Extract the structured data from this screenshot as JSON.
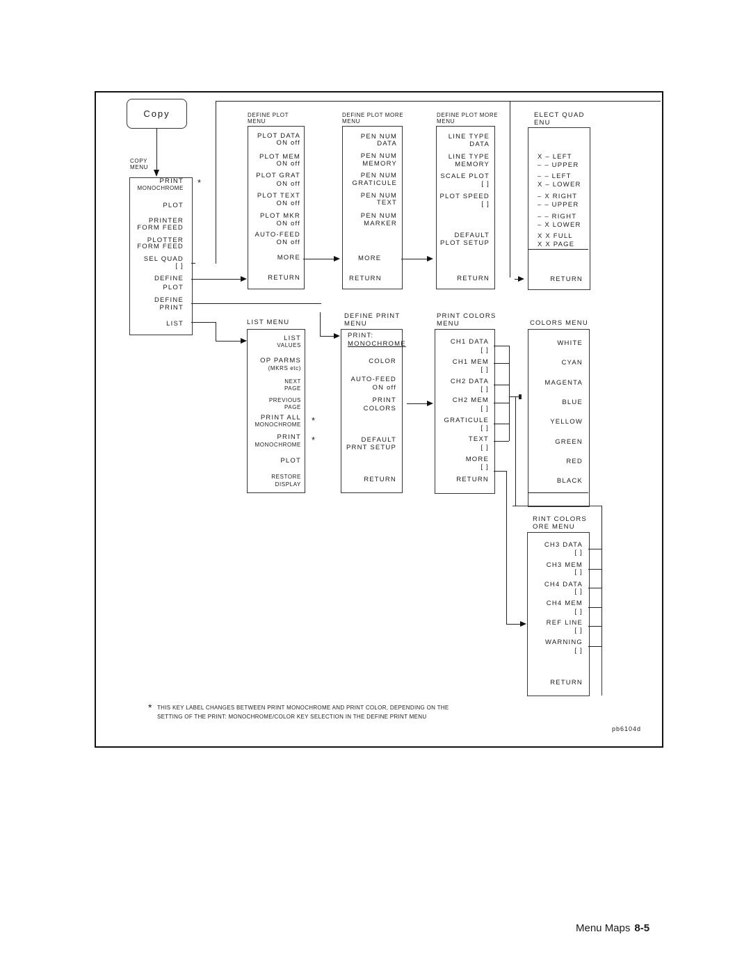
{
  "copy_key": "Copy",
  "menus": {
    "copy": {
      "title": [
        "COPY",
        "MENU"
      ],
      "items": [
        [
          "PRINT",
          "MONOCHROME"
        ],
        [
          "PLOT"
        ],
        [
          "PRINTER",
          "FORM FEED"
        ],
        [
          "PLOTTER",
          "FORM FEED"
        ],
        [
          "SEL QUAD",
          "[ ]"
        ],
        [
          "DEFINE",
          "PLOT"
        ],
        [
          "DEFINE",
          "PRINT"
        ],
        [
          "LIST"
        ]
      ]
    },
    "define_plot": {
      "title": [
        "DEFINE PLOT",
        "MENU"
      ],
      "items": [
        [
          "PLOT DATA",
          "ON off"
        ],
        [
          "PLOT MEM",
          "ON off"
        ],
        [
          "PLOT GRAT",
          "ON off"
        ],
        [
          "PLOT TEXT",
          "ON off"
        ],
        [
          "PLOT MKR",
          "ON off"
        ],
        [
          "AUTO-FEED",
          "ON off"
        ],
        [
          "MORE"
        ],
        [
          "RETURN"
        ]
      ]
    },
    "define_plot_more_1": {
      "title": [
        "DEFINE PLOT MORE",
        "MENU"
      ],
      "items": [
        [
          "PEN NUM",
          "DATA"
        ],
        [
          "PEN NUM",
          "MEMORY"
        ],
        [
          "PEN NUM",
          "GRATICULE"
        ],
        [
          "PEN NUM",
          "TEXT"
        ],
        [
          "PEN NUM",
          "MARKER"
        ],
        [
          "MORE"
        ],
        [
          "RETURN"
        ]
      ]
    },
    "define_plot_more_2": {
      "title": [
        "DEFINE PLOT MORE",
        "MENU"
      ],
      "items": [
        [
          "LINE TYPE",
          "DATA"
        ],
        [
          "LINE TYPE",
          "MEMORY"
        ],
        [
          "SCALE PLOT",
          "[ ]"
        ],
        [
          "PLOT SPEED",
          "[ ]"
        ],
        [
          "DEFAULT",
          "PLOT SETUP"
        ],
        [
          "RETURN"
        ]
      ]
    },
    "select_quad": {
      "title": [
        "ELECT QUAD",
        "ENU"
      ],
      "items": [
        [
          "X – LEFT",
          "– – UPPER"
        ],
        [
          "– – LEFT",
          "X – LOWER"
        ],
        [
          "– X RIGHT",
          "– – UPPER"
        ],
        [
          "– – RIGHT",
          "– X LOWER"
        ],
        [
          "X X FULL",
          "X X PAGE"
        ],
        [
          "RETURN"
        ]
      ]
    },
    "list": {
      "title": [
        "LIST MENU"
      ],
      "items": [
        [
          "LIST",
          "VALUES"
        ],
        [
          "OP PARMS",
          "(MKRS etc)"
        ],
        [
          "NEXT",
          "PAGE"
        ],
        [
          "PREVIOUS",
          "PAGE"
        ],
        [
          "PRINT ALL",
          "MONOCHROME"
        ],
        [
          "PRINT",
          "MONOCHROME"
        ],
        [
          "PLOT"
        ],
        [
          "RESTORE",
          "DISPLAY"
        ]
      ]
    },
    "define_print": {
      "title": [
        "DEFINE PRINT",
        "MENU"
      ],
      "items": [
        [
          "PRINT:",
          "MONOCHROME"
        ],
        [
          "COLOR"
        ],
        [
          "AUTO-FEED",
          "ON off"
        ],
        [
          "PRINT",
          "COLORS"
        ],
        [
          "DEFAULT",
          "PRNT SETUP"
        ],
        [
          "RETURN"
        ]
      ]
    },
    "print_colors": {
      "title": [
        "PRINT COLORS",
        "MENU"
      ],
      "items": [
        [
          "CH1 DATA",
          "[ ]"
        ],
        [
          "CH1 MEM",
          "[ ]"
        ],
        [
          "CH2 DATA",
          "[ ]"
        ],
        [
          "CH2 MEM",
          "[ ]"
        ],
        [
          "GRATICULE",
          "[ ]"
        ],
        [
          "TEXT",
          "[ ]"
        ],
        [
          "MORE",
          "[ ]"
        ],
        [
          "RETURN"
        ]
      ]
    },
    "colors": {
      "title": [
        "COLORS MENU"
      ],
      "items": [
        [
          "WHITE"
        ],
        [
          "CYAN"
        ],
        [
          "MAGENTA"
        ],
        [
          "BLUE"
        ],
        [
          "YELLOW"
        ],
        [
          "GREEN"
        ],
        [
          "RED"
        ],
        [
          "BLACK"
        ]
      ]
    },
    "print_colors_more": {
      "title": [
        "RINT COLORS",
        "ORE MENU"
      ],
      "items": [
        [
          "CH3 DATA",
          "[ ]"
        ],
        [
          "CH3 MEM",
          "[ ]"
        ],
        [
          "CH4 DATA",
          "[ ]"
        ],
        [
          "CH4 MEM",
          "[ ]"
        ],
        [
          "REF LINE",
          "[ ]"
        ],
        [
          "WARNING",
          "[ ]"
        ],
        [
          "RETURN"
        ]
      ]
    }
  },
  "asterisk": "*",
  "footnote": [
    "THIS KEY LABEL CHANGES BETWEEN PRINT MONOCHROME AND PRINT COLOR, DEPENDING ON THE",
    "SETTING OF THE PRINT: MONOCHROME/COLOR KEY SELECTION IN THE DEFINE PRINT MENU"
  ],
  "figure_id": "pb6104d",
  "page_footer": {
    "section": "Menu Maps",
    "page": "8-5"
  }
}
